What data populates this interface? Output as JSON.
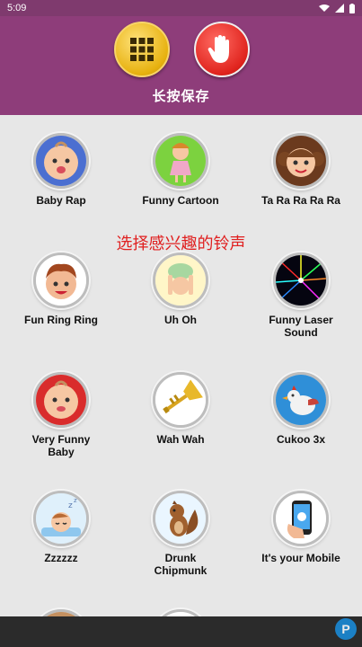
{
  "status_bar": {
    "time": "5:09",
    "icons": [
      "wifi-icon",
      "signal-icon",
      "battery-icon"
    ]
  },
  "header": {
    "title": "长按保存",
    "buttons": [
      {
        "name": "grid-menu-button",
        "icon": "grid-icon"
      },
      {
        "name": "stop-hand-button",
        "icon": "stop-hand-icon"
      }
    ]
  },
  "hint": "选择感兴趣的铃声",
  "ringtones": [
    {
      "label": "Baby Rap",
      "icon": "baby-face-icon"
    },
    {
      "label": "Funny Cartoon",
      "icon": "cartoon-girl-icon"
    },
    {
      "label": "Ta Ra Ra Ra Ra",
      "icon": "girl-pigtails-icon"
    },
    {
      "label": "Fun Ring Ring",
      "icon": "boy-face-icon"
    },
    {
      "label": "Uh Oh",
      "icon": "baby-bending-icon"
    },
    {
      "label": "Funny Laser Sound",
      "icon": "laser-lights-icon"
    },
    {
      "label": "Very Funny Baby",
      "icon": "baby-face-icon"
    },
    {
      "label": "Wah Wah",
      "icon": "trumpet-icon"
    },
    {
      "label": "Cukoo 3x",
      "icon": "cuckoo-bird-icon"
    },
    {
      "label": "Zzzzzz",
      "icon": "sleeping-baby-icon"
    },
    {
      "label": "Drunk Chipmunk",
      "icon": "chipmunk-icon"
    },
    {
      "label": "It's your Mobile",
      "icon": "phone-hand-icon"
    }
  ],
  "colors": {
    "header": "#8e3d7a",
    "status_bar": "#7f3a6e",
    "hint": "#e02020",
    "grid_button": "#e7b10f",
    "stop_button": "#e0241e"
  }
}
